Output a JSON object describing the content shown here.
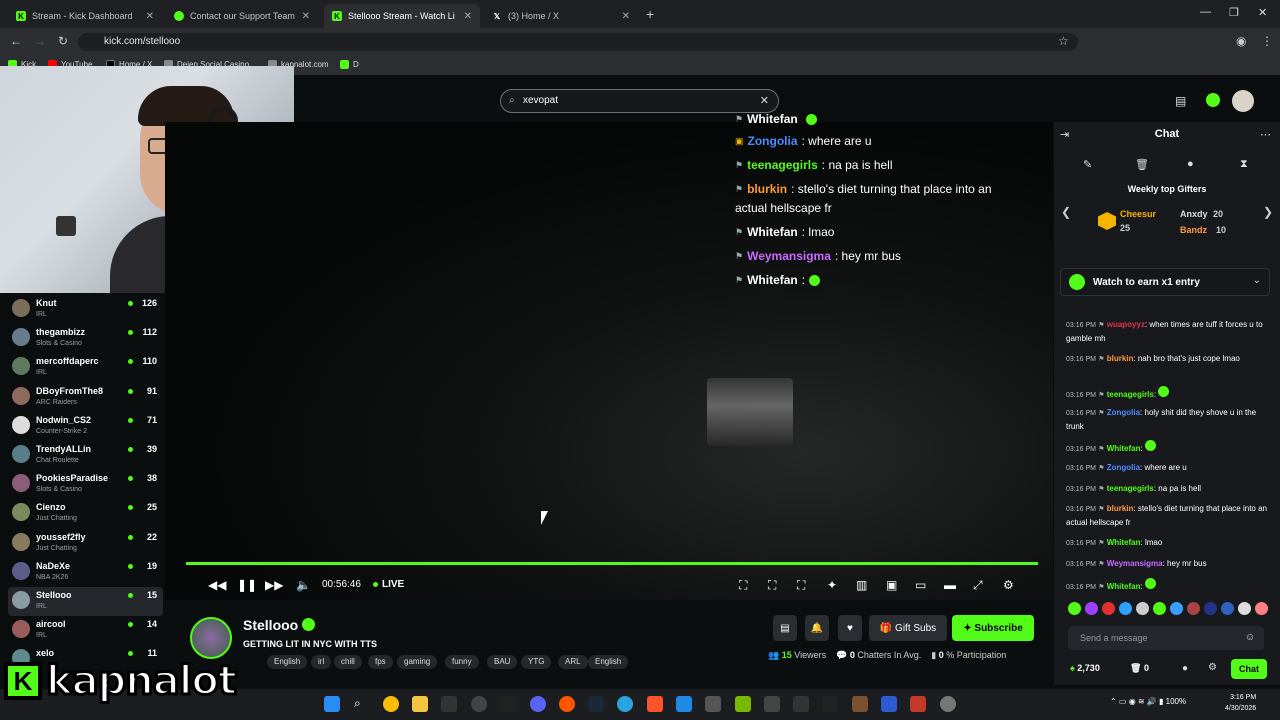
{
  "browser": {
    "tabs": [
      {
        "title": "Stream - Kick Dashboard",
        "fav": "kick"
      },
      {
        "title": "Contact our Support Team | Kic",
        "fav": "kick-c"
      },
      {
        "title": "Stellooo Stream - Watch Li",
        "fav": "kick",
        "active": true
      },
      {
        "title": "(3) Home / X",
        "fav": "x"
      }
    ],
    "url": "kick.com/stellooo",
    "bookmarks": [
      "Kick",
      "YouTube",
      "Home / X",
      "Deien Social Casino...",
      "kapnalot.com",
      "D"
    ]
  },
  "header": {
    "search_value": "xevopat"
  },
  "sidebar": {
    "channels": [
      {
        "name": "Knut",
        "category": "IRL",
        "viewers": "126"
      },
      {
        "name": "thegambizz",
        "category": "Slots & Casino",
        "viewers": "112"
      },
      {
        "name": "mercoffdaperc",
        "category": "IRL",
        "viewers": "110"
      },
      {
        "name": "DBoyFromThe8",
        "category": "ARC Raiders",
        "viewers": "91"
      },
      {
        "name": "Nodwin_CS2",
        "category": "Counter-Strike 2",
        "viewers": "71"
      },
      {
        "name": "TrendyALLin",
        "category": "Chat Roulette",
        "viewers": "39"
      },
      {
        "name": "PookiesParadise",
        "category": "Slots & Casino",
        "viewers": "38"
      },
      {
        "name": "Cienzo",
        "category": "Just Chatting",
        "viewers": "25"
      },
      {
        "name": "youssef2fly",
        "category": "Just Chatting",
        "viewers": "22"
      },
      {
        "name": "NaDeXe",
        "category": "NBA 2K26",
        "viewers": "19"
      },
      {
        "name": "Stellooo",
        "category": "IRL",
        "viewers": "15",
        "selected": true
      },
      {
        "name": "aircool",
        "category": "IRL",
        "viewers": "14"
      },
      {
        "name": "xelo",
        "category": "",
        "viewers": "11"
      }
    ]
  },
  "overlay_chat": [
    {
      "user": "Whitefan",
      "msg": "",
      "color": "#ffffff"
    },
    {
      "user": "Zongolia",
      "msg": ": where are u",
      "color": "#4d8cff"
    },
    {
      "user": "teenagegirls",
      "msg": ": na pa is hell",
      "color": "#53fc18"
    },
    {
      "user": "blurkin",
      "msg": ": stello's diet turning that place into an",
      "msg2": "actual hellscape fr",
      "color": "#ff9a3c"
    },
    {
      "user": "Whitefan",
      "msg": ": lmao",
      "color": "#ffffff"
    },
    {
      "user": "Weymansigma",
      "msg": ": hey mr bus",
      "color": "#c86bff"
    },
    {
      "user": "Whitefan",
      "msg": ":",
      "color": "#ffffff"
    }
  ],
  "player": {
    "time": "00:56:46",
    "live": "LIVE"
  },
  "stream": {
    "name": "Stellooo",
    "title": "GETTING LIT IN NYC WITH TTS",
    "tags": [
      "English",
      "irl",
      "chill",
      "fps",
      "gaming",
      "funny",
      "BAU",
      "YTG",
      "ARL",
      "English"
    ],
    "viewers": "15",
    "viewers_label": "Viewers",
    "chatters": "0",
    "chatters_label": "Chatters In Avg.",
    "participation": "0",
    "participation_label": "% Participation",
    "gift_label": "Gift Subs",
    "subscribe_label": "Subscribe"
  },
  "chat": {
    "title": "Chat",
    "weekly_title": "Weekly top Gifters",
    "gifters": [
      {
        "name": "Cheesur",
        "count": "25"
      },
      {
        "name": "Anxdy",
        "count": "20"
      },
      {
        "name": "Bandz",
        "count": "10"
      }
    ],
    "watch_banner": "Watch to earn x1 entry",
    "messages": [
      {
        "ts": "03:16 PM",
        "user": "wuapoyyz",
        "color": "#e0334a",
        "text": ": when times are tuff it forces u to gamble mh"
      },
      {
        "ts": "03:16 PM",
        "user": "blurkin",
        "color": "#ff9a3c",
        "text": ": nah bro that's just cope lmao"
      },
      {
        "ts": "03:16 PM",
        "user": "teenagegirls",
        "color": "#53fc18",
        "text": ":"
      },
      {
        "ts": "03:16 PM",
        "user": "Zongolia",
        "color": "#4d8cff",
        "text": ": holy shit did they shove u in the trunk"
      },
      {
        "ts": "03:16 PM",
        "user": "Whitefan",
        "color": "#53fc18",
        "text": ":"
      },
      {
        "ts": "03:16 PM",
        "user": "Zongolia",
        "color": "#4d8cff",
        "text": ": where are u"
      },
      {
        "ts": "03:16 PM",
        "user": "teenagegirls",
        "color": "#53fc18",
        "text": ": na pa is hell"
      },
      {
        "ts": "03:16 PM",
        "user": "blurkin",
        "color": "#ff9a3c",
        "text": ": stello's diet turning that place into an actual hellscape fr"
      },
      {
        "ts": "03:16 PM",
        "user": "Whitefan",
        "color": "#53fc18",
        "text": ": lmao"
      },
      {
        "ts": "03:16 PM",
        "user": "Weymansigma",
        "color": "#c86bff",
        "text": ": hey mr bus"
      },
      {
        "ts": "03:16 PM",
        "user": "Whitefan",
        "color": "#53fc18",
        "text": ":"
      }
    ],
    "input_placeholder": "Send a message",
    "points": "2,730",
    "points2": "0",
    "send_label": "Chat"
  },
  "taskbar": {
    "time": "3:16 PM",
    "date": "4/30/2026",
    "battery": "100%"
  },
  "watermark": "kapnalot",
  "colors": {
    "accent": "#53fc18",
    "bg": "#0b0e0f",
    "panel": "#18191c"
  }
}
